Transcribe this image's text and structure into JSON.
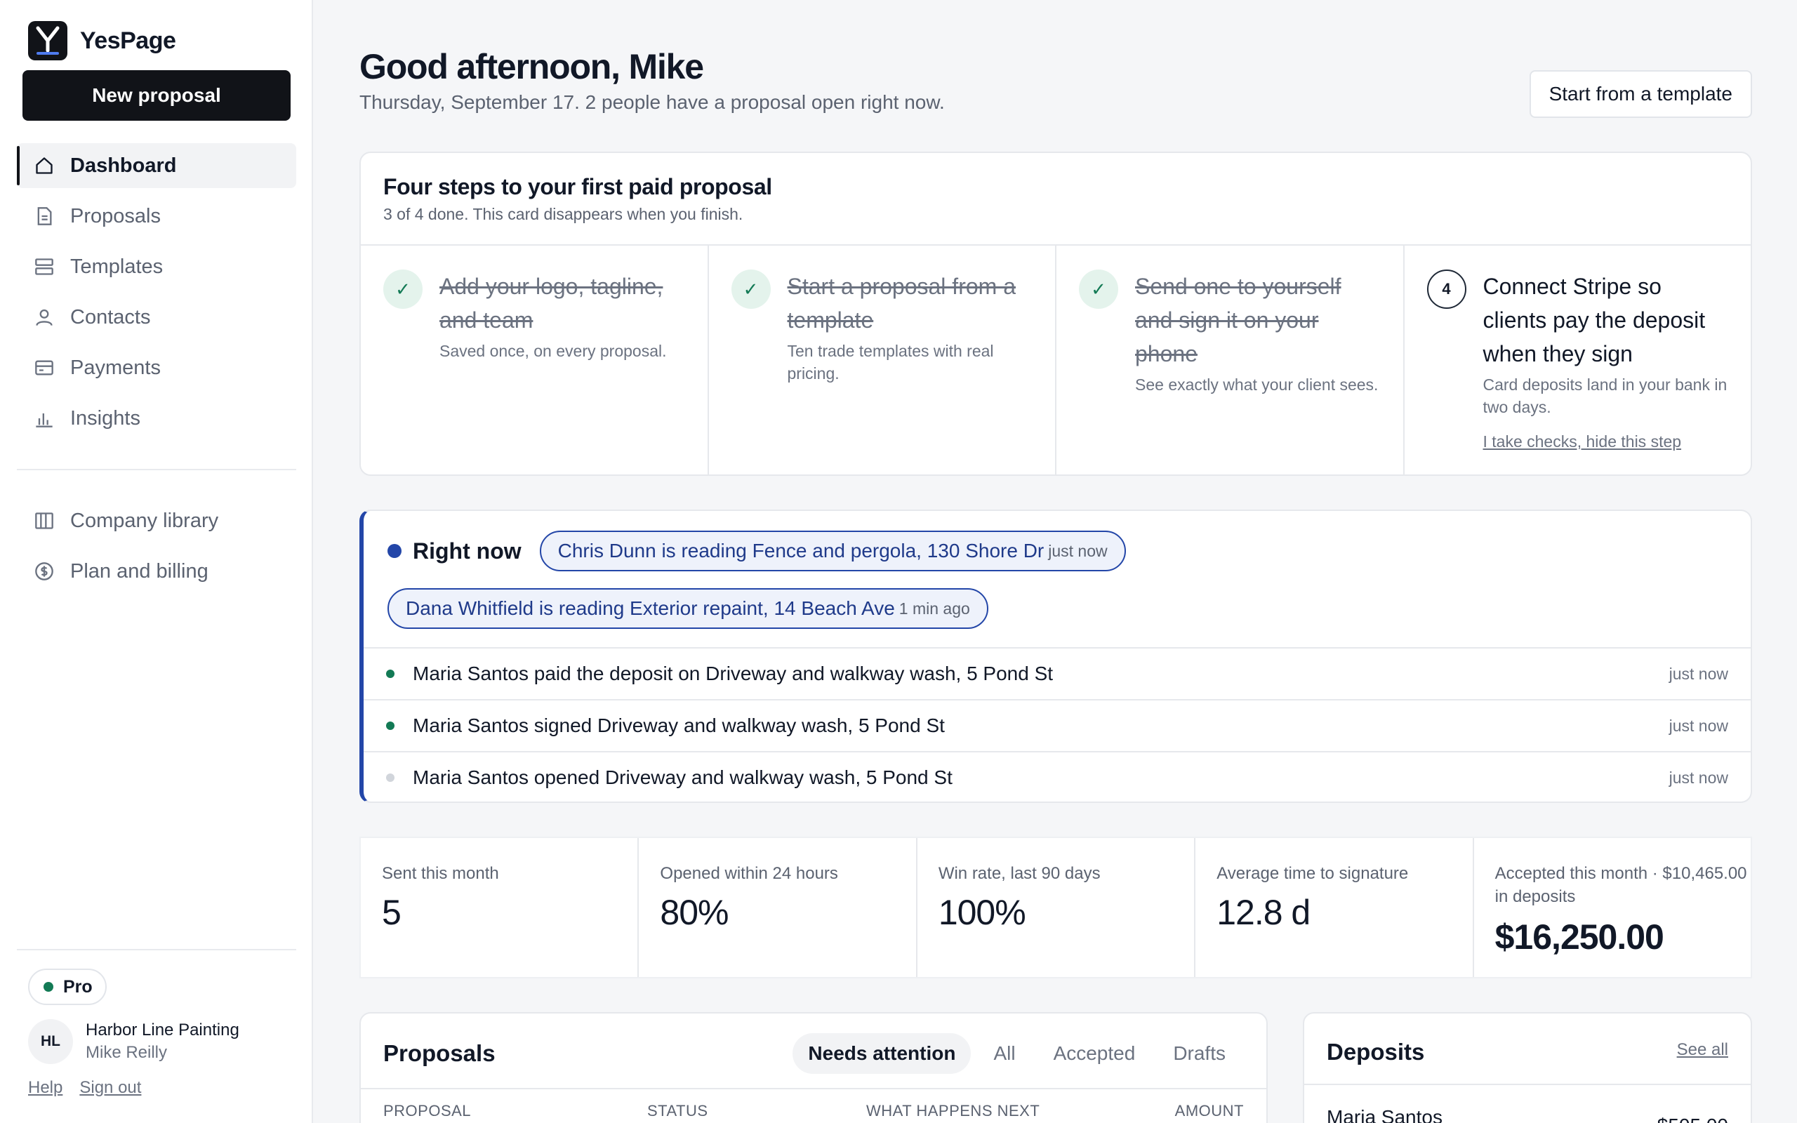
{
  "brand": {
    "name": "YesPage"
  },
  "sidebar": {
    "new_button": "New proposal",
    "nav": [
      {
        "label": "Dashboard",
        "icon": "home-icon",
        "active": true
      },
      {
        "label": "Proposals",
        "icon": "document-icon"
      },
      {
        "label": "Templates",
        "icon": "template-icon"
      },
      {
        "label": "Contacts",
        "icon": "person-icon"
      },
      {
        "label": "Payments",
        "icon": "card-icon"
      },
      {
        "label": "Insights",
        "icon": "bar-chart-icon"
      }
    ],
    "secondary": [
      {
        "label": "Company library",
        "icon": "library-icon"
      },
      {
        "label": "Plan and billing",
        "icon": "billing-icon"
      }
    ],
    "plan": "Pro",
    "account": {
      "initials": "HL",
      "company": "Harbor Line Painting",
      "user": "Mike Reilly"
    },
    "links": {
      "help": "Help",
      "signout": "Sign out"
    }
  },
  "header": {
    "greeting": "Good afternoon, Mike",
    "subtitle": "Thursday, September 17. 2 people have a proposal open right now.",
    "template_button": "Start from a template"
  },
  "onboarding": {
    "title": "Four steps to your first paid proposal",
    "subtitle": "3 of 4 done. This card disappears when you finish.",
    "steps": [
      {
        "done": true,
        "mark": "✓",
        "title": "Add your logo, tagline, and team",
        "desc": "Saved once, on every proposal."
      },
      {
        "done": true,
        "mark": "✓",
        "title": "Start a proposal from a template",
        "desc": "Ten trade templates with real pricing."
      },
      {
        "done": true,
        "mark": "✓",
        "title": "Send one to yourself and sign it on your phone",
        "desc": "See exactly what your client sees."
      },
      {
        "done": false,
        "mark": "4",
        "title": "Connect Stripe so clients pay the deposit when they sign",
        "desc": "Card deposits land in your bank in two days.",
        "link": "I take checks, hide this step"
      }
    ]
  },
  "live": {
    "label": "Right now",
    "readers": [
      {
        "text": "Chris Dunn is reading Fence and pergola, 130 Shore Dr",
        "time": "just now"
      },
      {
        "text": "Dana Whitfield is reading Exterior repaint, 14 Beach Ave",
        "time": "1 min ago"
      }
    ],
    "activity": [
      {
        "text": "Maria Santos paid the deposit on Driveway and walkway wash, 5 Pond St",
        "time": "just now",
        "color": "#137a55"
      },
      {
        "text": "Maria Santos signed Driveway and walkway wash, 5 Pond St",
        "time": "just now",
        "color": "#137a55"
      },
      {
        "text": "Maria Santos opened Driveway and walkway wash, 5 Pond St",
        "time": "just now",
        "color": "#d1d5db"
      }
    ]
  },
  "stats": [
    {
      "label": "Sent this month",
      "value": "5"
    },
    {
      "label": "Opened within 24 hours",
      "value": "80%"
    },
    {
      "label": "Win rate, last 90 days",
      "value": "100%"
    },
    {
      "label": "Average time to signature",
      "value": "12.8 d"
    },
    {
      "label": "Accepted this month · $10,465.00 in deposits",
      "value": "$16,250.00"
    }
  ],
  "proposals": {
    "title": "Proposals",
    "tabs": [
      "Needs attention",
      "All",
      "Accepted",
      "Drafts"
    ],
    "columns": [
      "PROPOSAL",
      "STATUS",
      "WHAT HAPPENS NEXT",
      "AMOUNT"
    ]
  },
  "deposits": {
    "title": "Deposits",
    "link": "See all",
    "rows": [
      {
        "name": "Maria Santos",
        "amount": "$505.00"
      }
    ]
  },
  "colors": {
    "accent": "#2346a8",
    "success": "#137a55",
    "dark": "#111318"
  }
}
